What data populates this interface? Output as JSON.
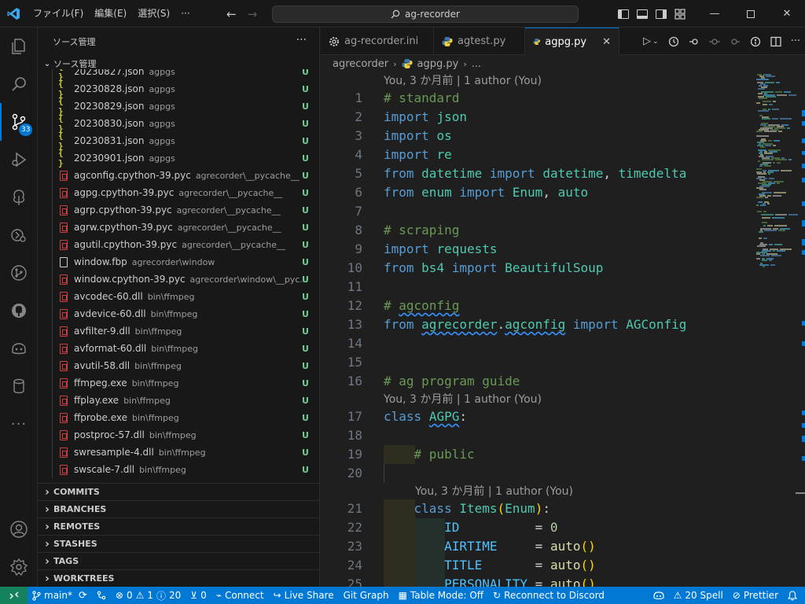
{
  "titlebar": {
    "menu": [
      "ファイル(F)",
      "編集(E)",
      "選択(S)",
      "···"
    ],
    "search_text": "ag-recorder"
  },
  "activity": {
    "scm_badge": "33"
  },
  "sidebar": {
    "title": "ソース管理",
    "section": "ソース管理",
    "files": [
      {
        "name": "20230827.json",
        "path": "agpgs",
        "status": "U",
        "type": "json"
      },
      {
        "name": "20230828.json",
        "path": "agpgs",
        "status": "U",
        "type": "json"
      },
      {
        "name": "20230829.json",
        "path": "agpgs",
        "status": "U",
        "type": "json"
      },
      {
        "name": "20230830.json",
        "path": "agpgs",
        "status": "U",
        "type": "json"
      },
      {
        "name": "20230831.json",
        "path": "agpgs",
        "status": "U",
        "type": "json"
      },
      {
        "name": "20230901.json",
        "path": "agpgs",
        "status": "U",
        "type": "json"
      },
      {
        "name": "agconfig.cpython-39.pyc",
        "path": "agrecorder\\__pycache__",
        "status": "U",
        "type": "bin"
      },
      {
        "name": "agpg.cpython-39.pyc",
        "path": "agrecorder\\__pycache__",
        "status": "U",
        "type": "bin"
      },
      {
        "name": "agrp.cpython-39.pyc",
        "path": "agrecorder\\__pycache__",
        "status": "U",
        "type": "bin"
      },
      {
        "name": "agrw.cpython-39.pyc",
        "path": "agrecorder\\__pycache__",
        "status": "U",
        "type": "bin"
      },
      {
        "name": "agutil.cpython-39.pyc",
        "path": "agrecorder\\__pycache__",
        "status": "U",
        "type": "bin"
      },
      {
        "name": "window.fbp",
        "path": "agrecorder\\window",
        "status": "U",
        "type": "doc"
      },
      {
        "name": "window.cpython-39.pyc",
        "path": "agrecorder\\window\\__pyc...",
        "status": "U",
        "type": "bin"
      },
      {
        "name": "avcodec-60.dll",
        "path": "bin\\ffmpeg",
        "status": "U",
        "type": "bin"
      },
      {
        "name": "avdevice-60.dll",
        "path": "bin\\ffmpeg",
        "status": "U",
        "type": "bin"
      },
      {
        "name": "avfilter-9.dll",
        "path": "bin\\ffmpeg",
        "status": "U",
        "type": "bin"
      },
      {
        "name": "avformat-60.dll",
        "path": "bin\\ffmpeg",
        "status": "U",
        "type": "bin"
      },
      {
        "name": "avutil-58.dll",
        "path": "bin\\ffmpeg",
        "status": "U",
        "type": "bin"
      },
      {
        "name": "ffmpeg.exe",
        "path": "bin\\ffmpeg",
        "status": "U",
        "type": "bin"
      },
      {
        "name": "ffplay.exe",
        "path": "bin\\ffmpeg",
        "status": "U",
        "type": "bin"
      },
      {
        "name": "ffprobe.exe",
        "path": "bin\\ffmpeg",
        "status": "U",
        "type": "bin"
      },
      {
        "name": "postproc-57.dll",
        "path": "bin\\ffmpeg",
        "status": "U",
        "type": "bin"
      },
      {
        "name": "swresample-4.dll",
        "path": "bin\\ffmpeg",
        "status": "U",
        "type": "bin"
      },
      {
        "name": "swscale-7.dll",
        "path": "bin\\ffmpeg",
        "status": "U",
        "type": "bin"
      }
    ],
    "sections": [
      "COMMITS",
      "BRANCHES",
      "REMOTES",
      "STASHES",
      "TAGS",
      "WORKTREES"
    ]
  },
  "tabs": [
    {
      "label": "ag-recorder.ini",
      "icon": "gear-icon",
      "active": false
    },
    {
      "label": "agtest.py",
      "icon": "python-icon",
      "active": false
    },
    {
      "label": "agpg.py",
      "icon": "python-icon",
      "active": true
    }
  ],
  "breadcrumb": {
    "folder": "agrecorder",
    "file": "agpg.py",
    "rest": "..."
  },
  "editor": {
    "lens_top": "You, 3 か月前 | 1 author (You)",
    "lens_class": "You, 3 か月前 | 1 author (You)",
    "lens_items": "You, 3 か月前 | 1 author (You)",
    "lines": [
      "1",
      "2",
      "3",
      "4",
      "5",
      "6",
      "7",
      "8",
      "9",
      "10",
      "11",
      "12",
      "13",
      "14",
      "15",
      "16",
      "17",
      "18",
      "19",
      "20",
      "21",
      "22",
      "23",
      "24",
      "25"
    ]
  },
  "statusbar": {
    "branch": "main*",
    "errors": "0",
    "warnings": "1",
    "infos": "20",
    "ports": "0",
    "connect": "Connect",
    "live_share": "Live Share",
    "git_graph": "Git Graph",
    "table_mode": "Table Mode: Off",
    "discord": "Reconnect to Discord",
    "spell": "20 Spell",
    "prettier": "Prettier"
  }
}
